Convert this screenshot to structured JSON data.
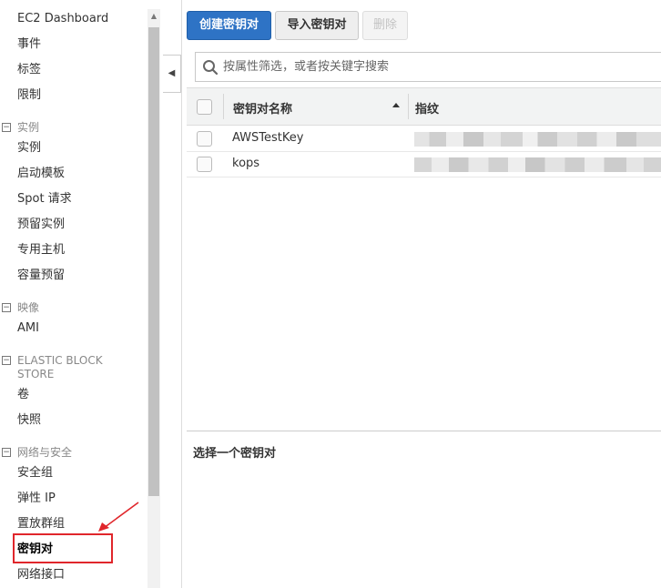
{
  "sidebar": {
    "top_items": [
      {
        "label": "EC2 Dashboard"
      },
      {
        "label": "事件"
      },
      {
        "label": "标签"
      },
      {
        "label": "限制"
      }
    ],
    "sections": [
      {
        "title": "实例",
        "items": [
          "实例",
          "启动模板",
          "Spot 请求",
          "预留实例",
          "专用主机",
          "容量预留"
        ]
      },
      {
        "title": "映像",
        "items": [
          "AMI"
        ]
      },
      {
        "title": "ELASTIC BLOCK STORE",
        "items": [
          "卷",
          "快照"
        ]
      },
      {
        "title": "网络与安全",
        "items": [
          "安全组",
          "弹性 IP",
          "置放群组",
          "密钥对",
          "网络接口"
        ]
      }
    ],
    "active_item": "密钥对"
  },
  "toolbar": {
    "create_label": "创建密钥对",
    "import_label": "导入密钥对",
    "delete_label": "删除"
  },
  "search": {
    "placeholder": "按属性筛选，或者按关键字搜索",
    "value": ""
  },
  "table": {
    "columns": [
      "密钥对名称",
      "指纹"
    ],
    "sort_column": "密钥对名称",
    "sort_direction": "ascending",
    "rows": [
      {
        "name": "AWSTestKey"
      },
      {
        "name": "kops"
      }
    ]
  },
  "detail": {
    "title": "选择一个密钥对"
  },
  "colors": {
    "primary_button": "#2e73c5",
    "annotation": "#e0262b",
    "selected_nav_text": "#000000"
  }
}
